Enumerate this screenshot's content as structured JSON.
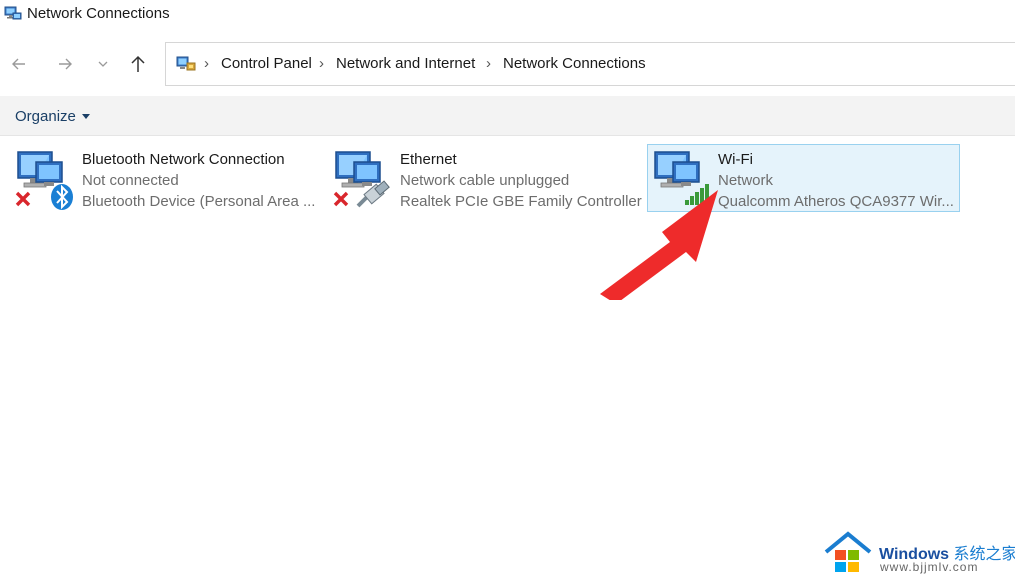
{
  "window": {
    "title": "Network Connections",
    "icon": "network-connections-icon"
  },
  "navigation": {
    "back_icon": "arrow-left-icon",
    "forward_icon": "arrow-right-icon",
    "recent_icon": "chevron-down-icon",
    "up_icon": "arrow-up-icon"
  },
  "address": {
    "icon": "control-panel-icon",
    "breadcrumbs": [
      "Control Panel",
      "Network and Internet",
      "Network Connections"
    ]
  },
  "commandbar": {
    "organize_label": "Organize"
  },
  "connections": [
    {
      "name": "Bluetooth Network Connection",
      "status": "Not connected",
      "device": "Bluetooth Device (Personal Area ...",
      "icon": "bluetooth-network-icon",
      "state": "disconnected"
    },
    {
      "name": "Ethernet",
      "status": "Network cable unplugged",
      "device": "Realtek PCIe GBE Family Controller",
      "icon": "ethernet-network-icon",
      "state": "unplugged"
    },
    {
      "name": "Wi-Fi",
      "status": "Network",
      "device": "Qualcomm Atheros QCA9377 Wir...",
      "icon": "wifi-network-icon",
      "state": "connected",
      "selected": true
    }
  ],
  "watermark": {
    "brand": "Windows",
    "brand_cn": "系统之家",
    "url": "www.bjjmlv.com"
  },
  "colors": {
    "selection_bg": "#e5f3fb",
    "selection_border": "#99d1ef",
    "annotation_arrow": "#ee2b2b",
    "error_x": "#d9262c",
    "bluetooth": "#1a7fd4",
    "wifi_bars": "#3a9a3a"
  }
}
